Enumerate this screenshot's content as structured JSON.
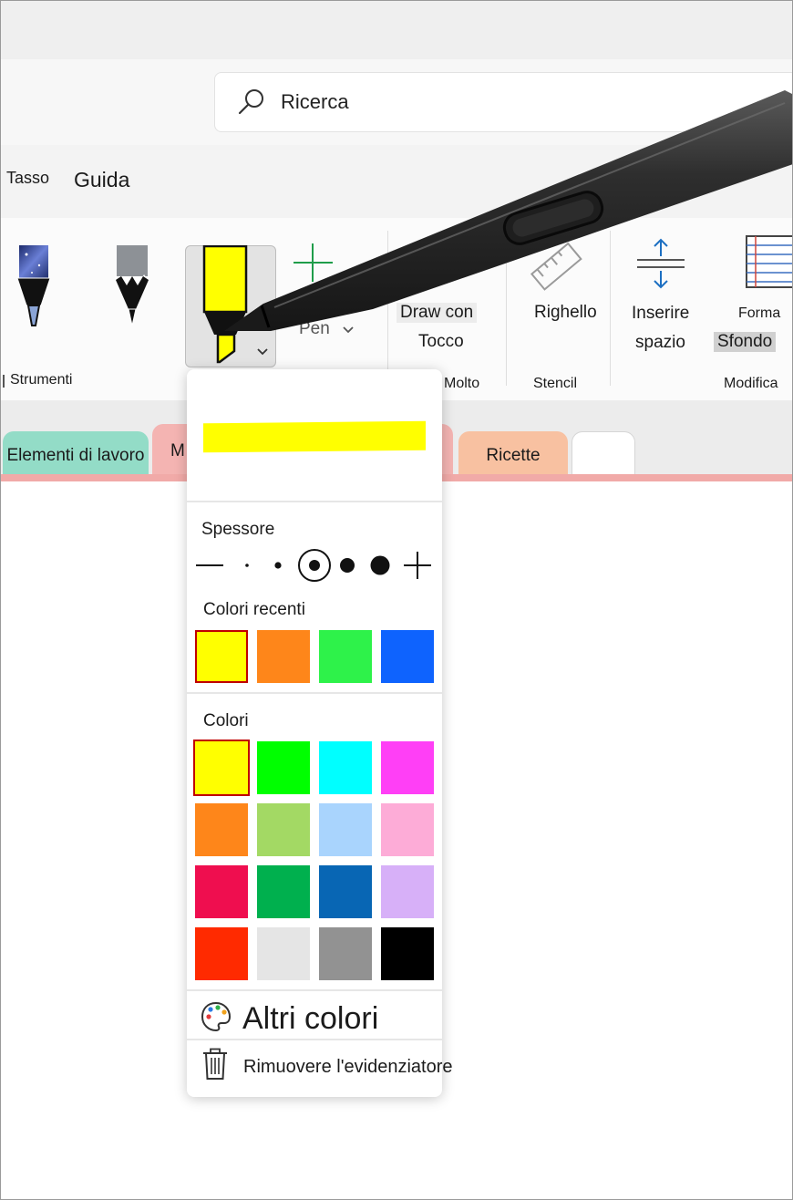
{
  "search": {
    "label": "Ricerca"
  },
  "menu": {
    "tasso_label": "Tasso",
    "guida_label": "Guida"
  },
  "ribbon": {
    "tools_group": "Strumenti",
    "pen_label": "Pen",
    "draw_label_1": "Draw con",
    "draw_label_2": "Tocco",
    "draw_group": "Molto",
    "ruler_label": "Righello",
    "stencil_group": "Stencil",
    "insert_label_1": "Inserire",
    "insert_label_2": "spazio",
    "forma_label": "Forma",
    "sfondo_label": "Sfondo",
    "modifica_group": "Modifica"
  },
  "tabs": [
    {
      "label": "Elementi di lavoro",
      "color": "#93dcc7"
    },
    {
      "label": "M",
      "color": "#f4b4b2"
    },
    {
      "label": "Ricette",
      "color": "#f8c1a1"
    },
    {
      "label": "",
      "color": "#ffffff"
    }
  ],
  "popup": {
    "preview_color": "#ffff00",
    "thickness_label": "Spessore",
    "selected_thickness_index": 2,
    "recent_label": "Colori recenti",
    "recent_colors": [
      "#ffff00",
      "#fe861a",
      "#2ef24a",
      "#0e63fe"
    ],
    "colors_label": "Colori",
    "colors": [
      "#ffff00",
      "#00ff00",
      "#00ffff",
      "#ff3ff6",
      "#fe861a",
      "#a3d964",
      "#a9d4fd",
      "#fdacd7",
      "#ef0e4f",
      "#00b04e",
      "#0866b4",
      "#d7b0f8",
      "#ff2a00",
      "#e5e5e5",
      "#929292",
      "#000000"
    ],
    "more_colors_label": "Altri colori",
    "remove_label": "Rimuovere l'evidenziatore"
  }
}
